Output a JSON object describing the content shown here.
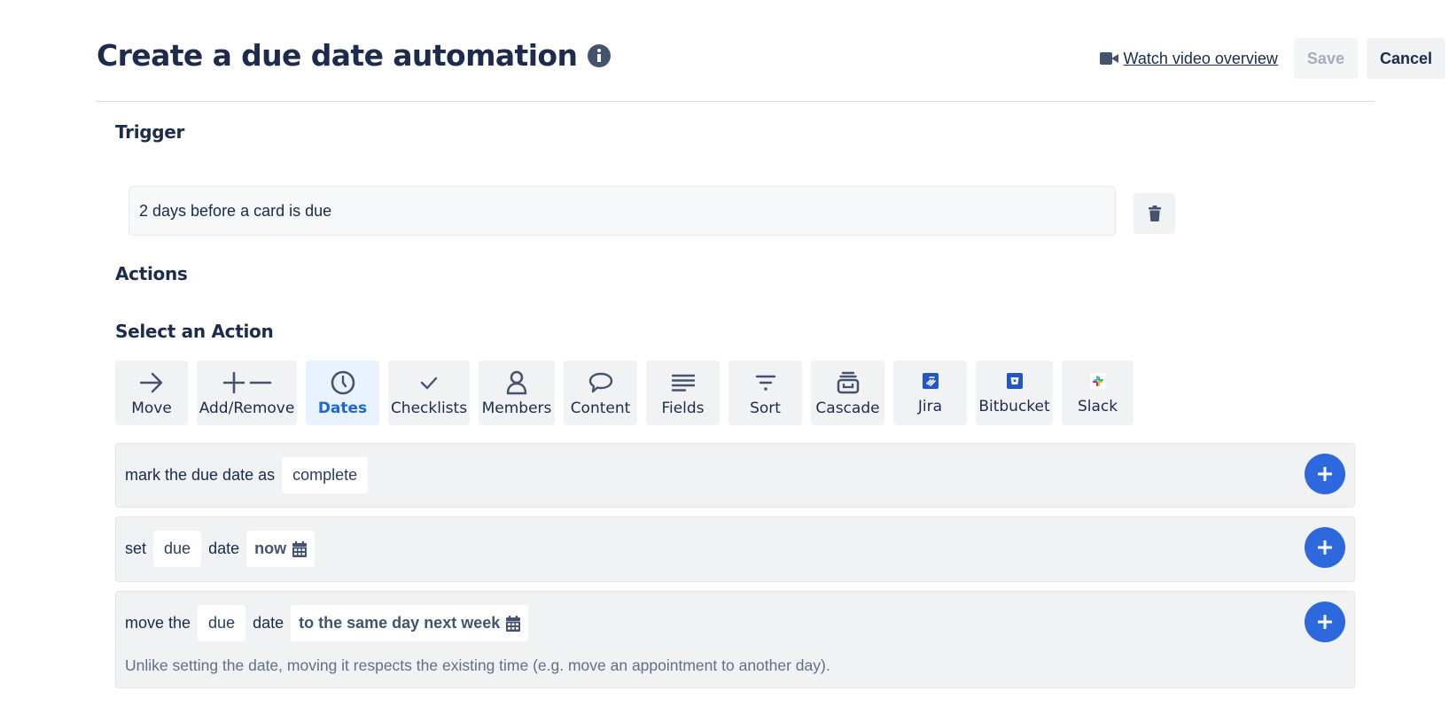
{
  "header": {
    "title": "Create a due date automation",
    "info_icon": "info-circle-icon",
    "video_link": "Watch video overview",
    "video_icon": "video-camera-icon",
    "save_label": "Save",
    "cancel_label": "Cancel"
  },
  "trigger": {
    "heading": "Trigger",
    "value": "2 days before a card is due",
    "delete_icon": "trash-icon"
  },
  "actions": {
    "heading": "Actions",
    "select_heading": "Select an Action",
    "active_tab": "Dates",
    "tabs": [
      {
        "label": "Move",
        "icon": "arrow-right-icon"
      },
      {
        "label": "Add/Remove",
        "icon": "plus-minus-icon"
      },
      {
        "label": "Dates",
        "icon": "clock-icon"
      },
      {
        "label": "Checklists",
        "icon": "checkmark-icon"
      },
      {
        "label": "Members",
        "icon": "person-icon"
      },
      {
        "label": "Content",
        "icon": "speech-bubble-icon"
      },
      {
        "label": "Fields",
        "icon": "lines-icon"
      },
      {
        "label": "Sort",
        "icon": "filter-icon"
      },
      {
        "label": "Cascade",
        "icon": "archive-box-icon"
      },
      {
        "label": "Jira",
        "icon": "jira-logo-icon"
      },
      {
        "label": "Bitbucket",
        "icon": "bitbucket-logo-icon"
      },
      {
        "label": "Slack",
        "icon": "slack-logo-icon"
      }
    ],
    "rows": [
      {
        "prefix": "mark the due date as",
        "chip": "complete"
      },
      {
        "prefix": "set",
        "chip1": "due",
        "middle": "date",
        "chip2": "now"
      },
      {
        "prefix": "move the",
        "chip1": "due",
        "middle": "date",
        "chip2": "to the same day next week",
        "hint": "Unlike setting the date, moving it respects the existing time (e.g. move an appointment to another day)."
      }
    ]
  },
  "colors": {
    "accent": "#2d69dc",
    "active_tab_bg": "#e9f2ff",
    "active_tab_text": "#1f65d6",
    "title_text": "#1d2b4c"
  }
}
